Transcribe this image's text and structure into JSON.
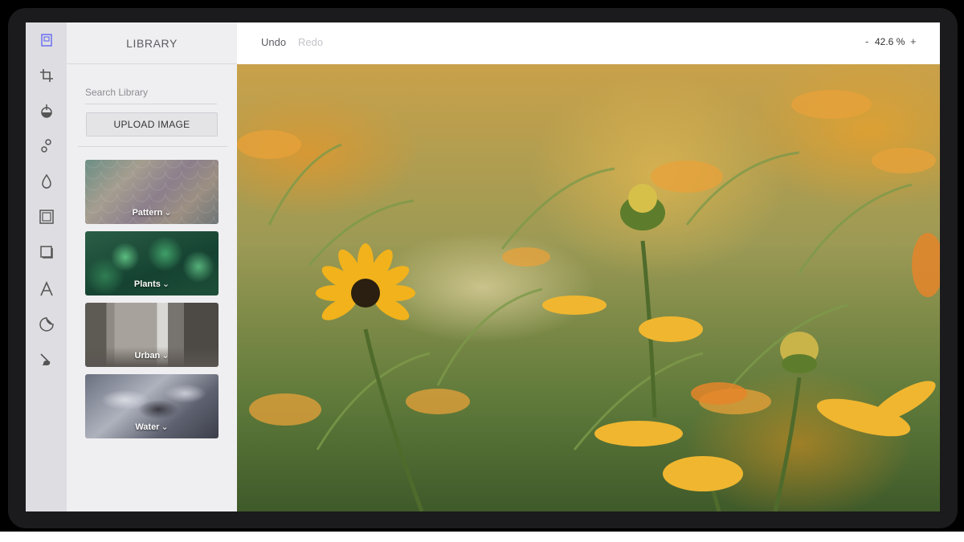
{
  "library": {
    "title": "LIBRARY",
    "search_placeholder": "Search Library",
    "upload_label": "UPLOAD IMAGE",
    "tiles": [
      {
        "label": "Pattern",
        "chevron": "⌄"
      },
      {
        "label": "Plants",
        "chevron": "⌄"
      },
      {
        "label": "Urban",
        "chevron": "⌄"
      },
      {
        "label": "Water",
        "chevron": "⌄"
      }
    ]
  },
  "toolbar": {
    "tools": [
      "library-icon",
      "crop-icon",
      "filter-icon",
      "adjust-icon",
      "focus-icon",
      "frame-icon",
      "overlay-icon",
      "text-icon",
      "sticker-icon",
      "brush-icon"
    ],
    "accent_color": "#6a6ff0"
  },
  "topbar": {
    "undo_label": "Undo",
    "redo_label": "Redo",
    "zoom_minus": "-",
    "zoom_value": "42.6 %",
    "zoom_plus": "+"
  },
  "canvas": {
    "subject": "yellow-flower-field-photo"
  }
}
